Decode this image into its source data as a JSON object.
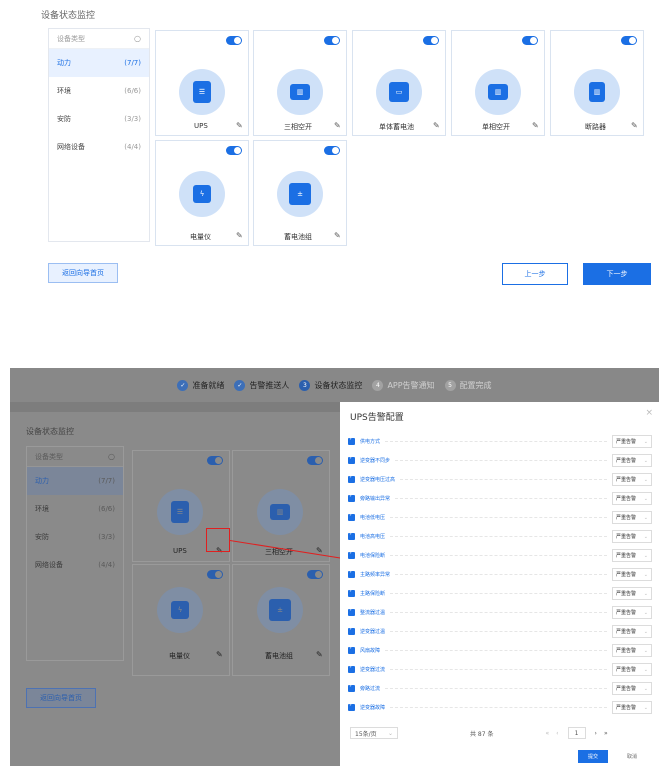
{
  "top": {
    "title": "设备状态监控",
    "sidebar": {
      "header": "设备类型",
      "search_icon": "search-icon",
      "items": [
        {
          "label": "动力",
          "count": "(7/7)",
          "active": true
        },
        {
          "label": "环境",
          "count": "(6/6)",
          "active": false
        },
        {
          "label": "安防",
          "count": "(3/3)",
          "active": false
        },
        {
          "label": "网络设备",
          "count": "(4/4)",
          "active": false
        }
      ]
    },
    "devices": [
      {
        "name": "UPS",
        "icon": "ups-icon",
        "enabled": true
      },
      {
        "name": "三相空开",
        "icon": "breaker-icon",
        "enabled": true
      },
      {
        "name": "单体蓄电池",
        "icon": "battery-icon",
        "enabled": true
      },
      {
        "name": "单相空开",
        "icon": "breaker-icon",
        "enabled": true
      },
      {
        "name": "断路器",
        "icon": "circuit-breaker-icon",
        "enabled": true
      },
      {
        "name": "电量仪",
        "icon": "power-meter-icon",
        "enabled": true
      },
      {
        "name": "蓄电池组",
        "icon": "battery-pack-icon",
        "enabled": true
      }
    ],
    "back_label": "返回向导首页",
    "prev_label": "上一步",
    "next_label": "下一步"
  },
  "bottom": {
    "steps": [
      {
        "label": "准备就绪",
        "state": "done",
        "glyph": "✓"
      },
      {
        "label": "告警推送人",
        "state": "done",
        "glyph": "✓"
      },
      {
        "label": "设备状态监控",
        "state": "current",
        "glyph": "3"
      },
      {
        "label": "APP告警通知",
        "state": "todo",
        "glyph": "4"
      },
      {
        "label": "配置完成",
        "state": "todo",
        "glyph": "5"
      }
    ],
    "title": "设备状态监控",
    "sidebar": {
      "header": "设备类型",
      "items": [
        {
          "label": "动力",
          "count": "(7/7)"
        },
        {
          "label": "环境",
          "count": "(6/6)"
        },
        {
          "label": "安防",
          "count": "(3/3)"
        },
        {
          "label": "网络设备",
          "count": "(4/4)"
        }
      ]
    },
    "devices": [
      "UPS",
      "三相空开",
      "电量仪",
      "蓄电池组"
    ],
    "back_label": "返回向导首页",
    "modal": {
      "title": "UPS告警配置",
      "close": "×",
      "alarms": [
        {
          "name": "供电方式",
          "level": "严重告警"
        },
        {
          "name": "逆变器不同步",
          "level": "严重告警"
        },
        {
          "name": "逆变器电压过高",
          "level": "严重告警"
        },
        {
          "name": "旁路输出异常",
          "level": "严重告警"
        },
        {
          "name": "电池低电压",
          "level": "严重告警"
        },
        {
          "name": "电池高电压",
          "level": "严重告警"
        },
        {
          "name": "电池保险断",
          "level": "严重告警"
        },
        {
          "name": "主路频率异常",
          "level": "严重告警"
        },
        {
          "name": "主路保险断",
          "level": "严重告警"
        },
        {
          "name": "整流器过温",
          "level": "严重告警"
        },
        {
          "name": "逆变器过温",
          "level": "严重告警"
        },
        {
          "name": "风扇故障",
          "level": "严重告警"
        },
        {
          "name": "逆变器过流",
          "level": "严重告警"
        },
        {
          "name": "旁路过流",
          "level": "严重告警"
        },
        {
          "name": "逆变器故障",
          "level": "严重告警"
        }
      ],
      "page_size": "15条/页",
      "total": "共 87 条",
      "page": "1",
      "submit": "提交",
      "cancel": "取消"
    }
  },
  "colors": {
    "accent": "#1b6fe4",
    "card_circle": "#cfe1f8",
    "overlay": "#7d7d7d",
    "annotation": "#e02020"
  }
}
